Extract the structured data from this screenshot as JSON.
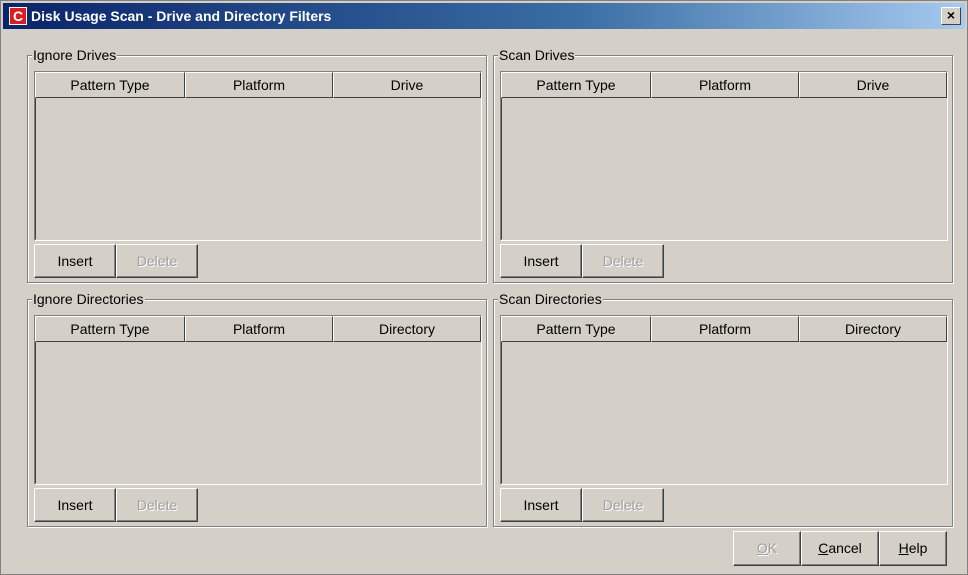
{
  "window": {
    "title": "Disk Usage Scan - Drive and Directory Filters",
    "icon_letter": "C",
    "close_label": "×"
  },
  "panels": {
    "ignore_drives": {
      "legend": "Ignore Drives",
      "columns": [
        "Pattern Type",
        "Platform",
        "Drive"
      ],
      "insert_label": "Insert",
      "delete_label": "Delete"
    },
    "scan_drives": {
      "legend": "Scan Drives",
      "columns": [
        "Pattern Type",
        "Platform",
        "Drive"
      ],
      "insert_label": "Insert",
      "delete_label": "Delete"
    },
    "ignore_directories": {
      "legend": "Ignore Directories",
      "columns": [
        "Pattern Type",
        "Platform",
        "Directory"
      ],
      "insert_label": "Insert",
      "delete_label": "Delete"
    },
    "scan_directories": {
      "legend": "Scan Directories",
      "columns": [
        "Pattern Type",
        "Platform",
        "Directory"
      ],
      "insert_label": "Insert",
      "delete_label": "Delete"
    }
  },
  "footer": {
    "ok_mnemonic": "O",
    "ok_rest": "K",
    "cancel_mnemonic": "C",
    "cancel_rest": "ancel",
    "help_mnemonic": "H",
    "help_rest": "elp"
  }
}
